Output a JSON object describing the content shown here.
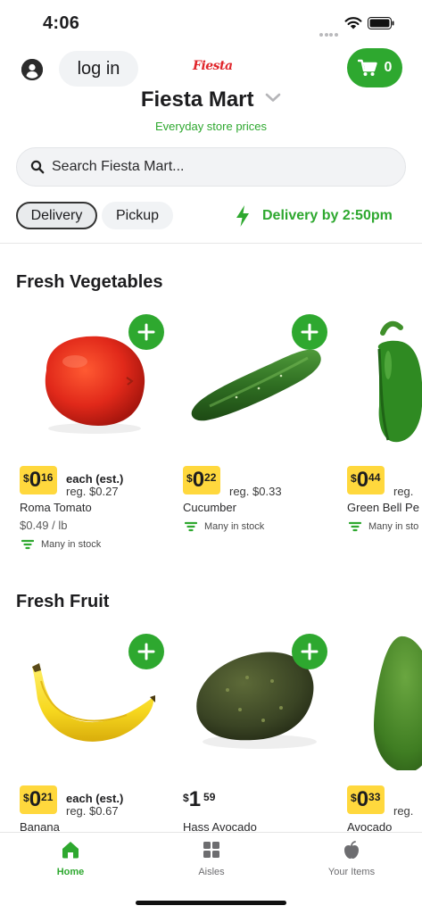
{
  "status_bar": {
    "time": "4:06"
  },
  "header": {
    "login_label": "log in",
    "logo_text": "Fiesta",
    "cart_count": "0",
    "store_name": "Fiesta Mart",
    "store_subtitle": "Everyday store prices"
  },
  "search": {
    "placeholder": "Search Fiesta Mart..."
  },
  "fulfillment": {
    "delivery_label": "Delivery",
    "pickup_label": "Pickup",
    "selected": "Delivery",
    "delivery_eta": "Delivery by 2:50pm"
  },
  "sections": [
    {
      "title": "Fresh Vegetables",
      "products": [
        {
          "name": "Roma Tomato",
          "price_dollars": "0",
          "price_cents": "16",
          "price_label": "each (est.)",
          "reg_price": "reg. $0.27",
          "unit_price": "$0.49 / lb",
          "stock": "Many in stock"
        },
        {
          "name": "Cucumber",
          "price_dollars": "0",
          "price_cents": "22",
          "price_label": "",
          "reg_price": "reg. $0.33",
          "unit_price": "",
          "stock": "Many in stock"
        },
        {
          "name": "Green Bell Pe",
          "price_dollars": "0",
          "price_cents": "44",
          "price_label": "",
          "reg_price": "reg.",
          "unit_price": "",
          "stock": "Many in sto"
        }
      ]
    },
    {
      "title": "Fresh Fruit",
      "products": [
        {
          "name": "Banana",
          "price_dollars": "0",
          "price_cents": "21",
          "price_label": "each (est.)",
          "reg_price": "reg. $0.67",
          "unit_price": "",
          "stock": ""
        },
        {
          "name": "Hass Avocado",
          "price_dollars": "1",
          "price_cents": "59",
          "price_label": "",
          "reg_price": "",
          "unit_price": "",
          "stock": ""
        },
        {
          "name": "Avocado",
          "price_dollars": "0",
          "price_cents": "33",
          "price_label": "",
          "reg_price": "reg.",
          "unit_price": "",
          "stock": ""
        }
      ]
    }
  ],
  "currency_symbol": "$",
  "tabbar": {
    "home_label": "Home",
    "aisles_label": "Aisles",
    "your_items_label": "Your Items",
    "active": "Home"
  },
  "colors": {
    "brand_green": "#2ea82f",
    "sale_yellow": "#ffd83d",
    "logo_red": "#e0262b"
  }
}
